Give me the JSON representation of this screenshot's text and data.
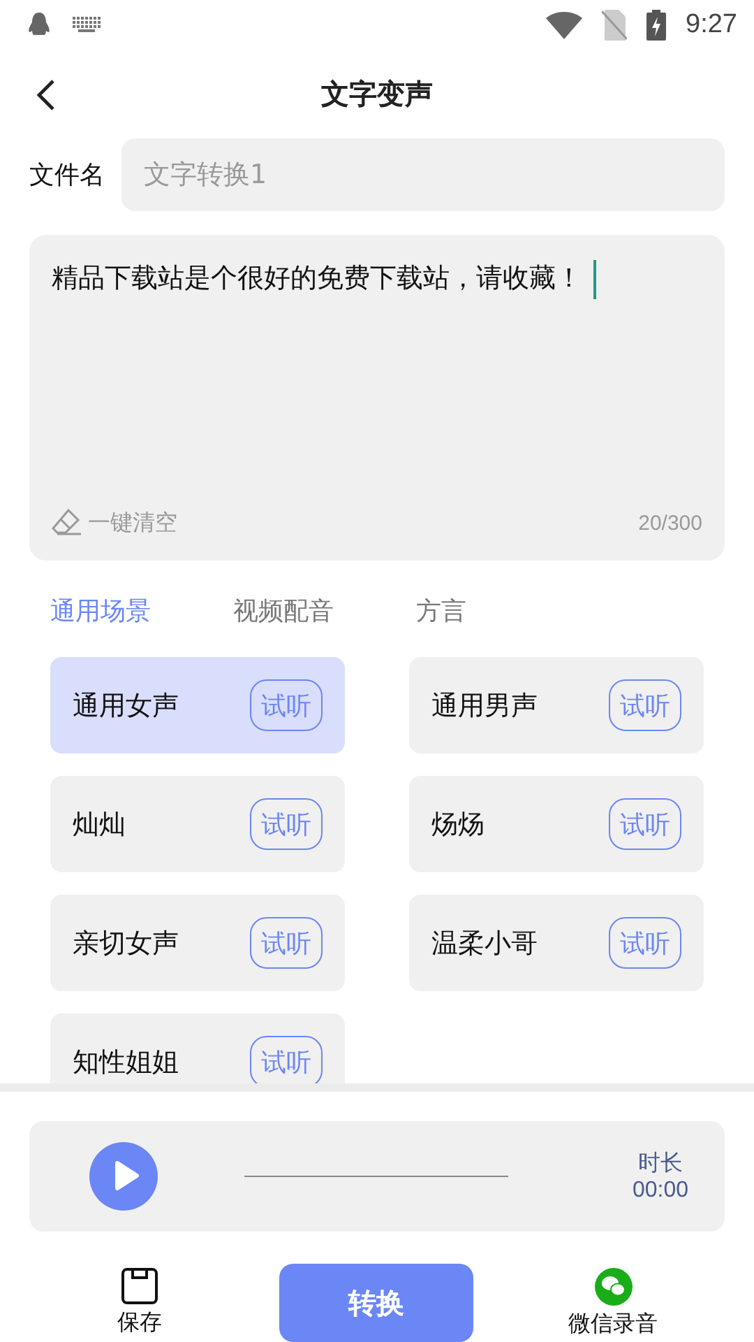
{
  "status_bar": {
    "time": "9:27"
  },
  "header": {
    "title": "文字变声"
  },
  "file_name": {
    "label": "文件名",
    "placeholder": "文字转换1"
  },
  "editor": {
    "value": "精品下载站是个很好的免费下载站，请收藏！",
    "clear_label": "一键清空",
    "count": "20/300"
  },
  "tabs": [
    {
      "label": "通用场景",
      "selected": true
    },
    {
      "label": "视频配音",
      "selected": false
    },
    {
      "label": "方言",
      "selected": false
    }
  ],
  "voices": [
    {
      "name": "通用女声",
      "preview": "试听",
      "selected": true
    },
    {
      "name": "通用男声",
      "preview": "试听",
      "selected": false
    },
    {
      "name": "灿灿",
      "preview": "试听",
      "selected": false
    },
    {
      "name": "炀炀",
      "preview": "试听",
      "selected": false
    },
    {
      "name": "亲切女声",
      "preview": "试听",
      "selected": false
    },
    {
      "name": "温柔小哥",
      "preview": "试听",
      "selected": false
    },
    {
      "name": "知性姐姐",
      "preview": "试听",
      "selected": false
    }
  ],
  "player": {
    "duration_label": "时长",
    "duration": "00:00"
  },
  "bottom_bar": {
    "save": "保存",
    "convert": "转换",
    "wechat": "微信录音"
  }
}
